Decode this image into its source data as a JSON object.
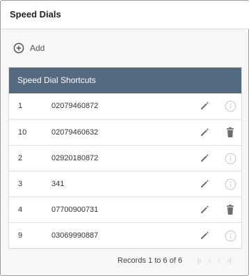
{
  "header": {
    "title": "Speed Dials"
  },
  "toolbar": {
    "add_label": "Add"
  },
  "table": {
    "heading": "Speed Dial Shortcuts",
    "rows": [
      {
        "id": "1",
        "number": "02079460872",
        "action": "info-icon"
      },
      {
        "id": "10",
        "number": "02079460632",
        "action": "trash-icon"
      },
      {
        "id": "2",
        "number": "02920180872",
        "action": "info-icon"
      },
      {
        "id": "3",
        "number": "341",
        "action": "info-icon"
      },
      {
        "id": "4",
        "number": "07700900731",
        "action": "trash-icon"
      },
      {
        "id": "9",
        "number": "03069990887",
        "action": "info-icon"
      }
    ]
  },
  "footer": {
    "records": "Records 1 to 6 of 6",
    "pager": {
      "first": "|‹",
      "prev": "‹",
      "next": "›",
      "last": "›|"
    }
  },
  "colors": {
    "table_header": "#536a80",
    "icon": "#6e6e6e",
    "icon_disabled": "#cfcfcf"
  }
}
